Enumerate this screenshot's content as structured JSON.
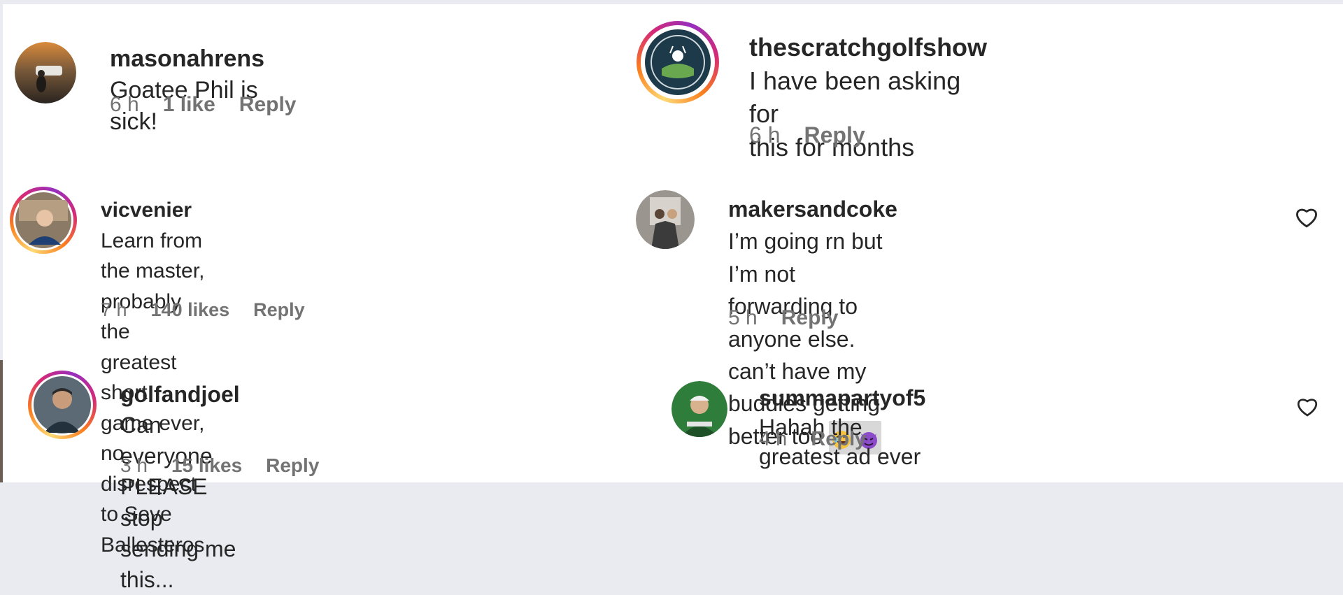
{
  "comments": [
    {
      "username": "masonahrens",
      "text": "Goatee Phil is sick!",
      "time": "6 h",
      "likes": "1 like",
      "reply": "Reply"
    },
    {
      "username": "thescratchgolfshow",
      "text": "I have been asking for",
      "text2": "this for months",
      "time": "6 h",
      "reply": "Reply"
    },
    {
      "username": "vicvenier",
      "text": "Learn from the master, probably",
      "text2": "the greatest short game ever, no disrespect",
      "text3": "to Seve Ballesteros",
      "time": "7 h",
      "likes": "140 likes",
      "reply": "Reply"
    },
    {
      "username": "makersandcoke",
      "text": "I’m going rn but I’m not",
      "text2": "forwarding to anyone else. can’t have my",
      "text3": "buddies getting better too",
      "emojis": [
        "😂",
        "😈"
      ],
      "time": "5 h",
      "reply": "Reply"
    },
    {
      "username": "golfandjoel",
      "text": "Can everyone PLEASE stop",
      "text2": "sending me this...",
      "time": "3 h",
      "likes": "15 likes",
      "reply": "Reply"
    },
    {
      "username": "summapartyof5",
      "text": "Hahah the greatest ad ever",
      "time": "4 h",
      "reply": "Reply"
    }
  ],
  "icons": {
    "like": "heart-outline-icon"
  }
}
